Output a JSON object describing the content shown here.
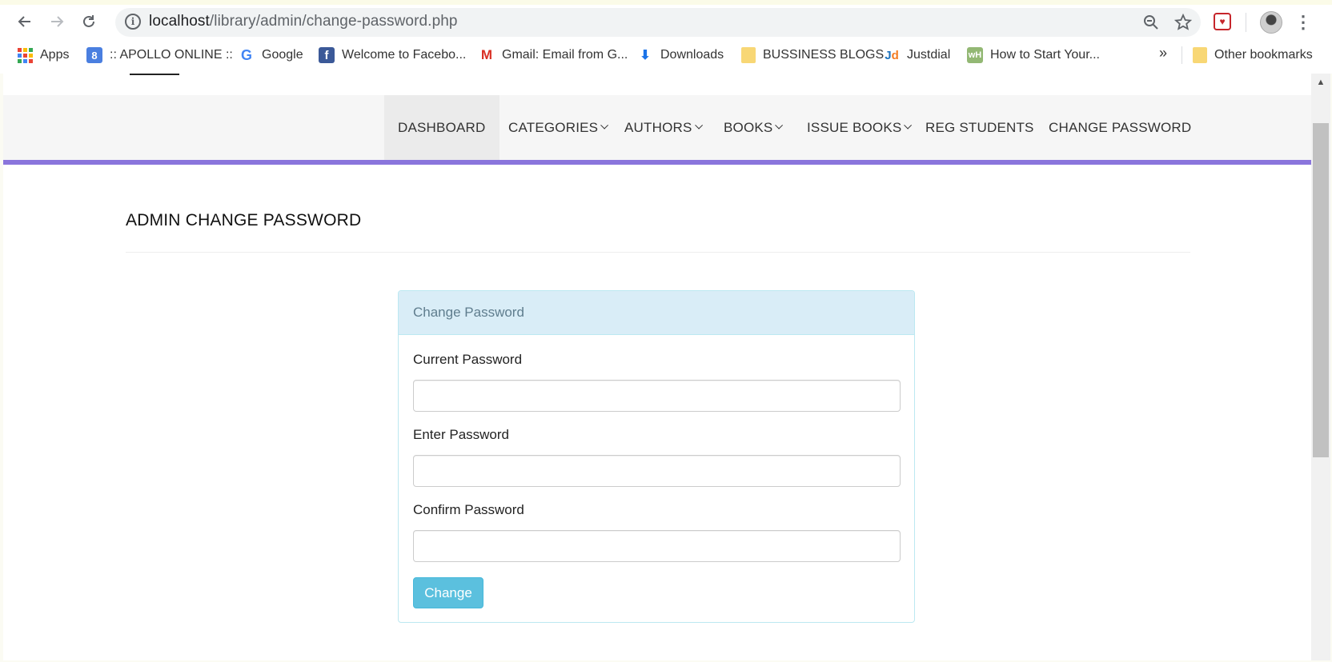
{
  "browser": {
    "url_host": "localhost",
    "url_path": "/library/admin/change-password.php",
    "bookmarks": [
      {
        "label": "Apps",
        "icon": "apps-grid-icon"
      },
      {
        "label": ":: APOLLO ONLINE ::",
        "icon": "apollo-icon"
      },
      {
        "label": "Google",
        "icon": "google-icon"
      },
      {
        "label": "Welcome to Facebo...",
        "icon": "facebook-icon"
      },
      {
        "label": "Gmail: Email from G...",
        "icon": "gmail-icon"
      },
      {
        "label": "Downloads",
        "icon": "download-icon"
      },
      {
        "label": "BUSSINESS BLOGS",
        "icon": "folder-icon"
      },
      {
        "label": "Justdial",
        "icon": "justdial-icon"
      },
      {
        "label": "How to Start Your...",
        "icon": "wikihow-icon"
      },
      {
        "label": "Other bookmarks",
        "icon": "folder-icon"
      }
    ],
    "more_bookmarks": "»"
  },
  "navbar": {
    "items": [
      {
        "label": "DASHBOARD",
        "dropdown": false,
        "active": true
      },
      {
        "label": "CATEGORIES",
        "dropdown": true
      },
      {
        "label": "AUTHORS",
        "dropdown": true
      },
      {
        "label": "BOOKS",
        "dropdown": true
      },
      {
        "label": "ISSUE BOOKS",
        "dropdown": true
      },
      {
        "label": "REG STUDENTS",
        "dropdown": false
      },
      {
        "label": "CHANGE PASSWORD",
        "dropdown": false
      }
    ],
    "accent_color": "#8a75dc"
  },
  "page": {
    "heading": "ADMIN CHANGE PASSWORD"
  },
  "panel": {
    "title": "Change Password",
    "fields": {
      "current": {
        "label": "Current Password",
        "value": ""
      },
      "new": {
        "label": "Enter Password",
        "value": ""
      },
      "confirm": {
        "label": "Confirm Password",
        "value": ""
      }
    },
    "submit_label": "Change",
    "heading_color": "#d9edf7",
    "button_color": "#5bc0de"
  }
}
